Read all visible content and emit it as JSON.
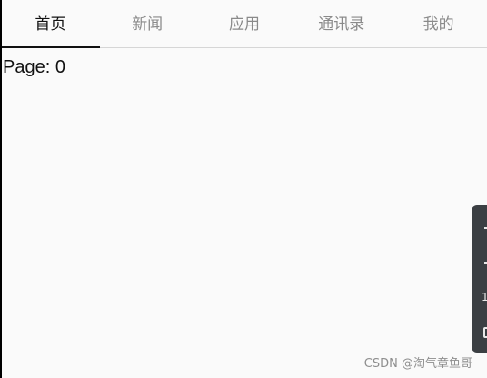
{
  "tabs": [
    {
      "label": "首页",
      "active": true
    },
    {
      "label": "新闻",
      "active": false
    },
    {
      "label": "应用",
      "active": false
    },
    {
      "label": "通讯录",
      "active": false
    },
    {
      "label": "我的",
      "active": false
    }
  ],
  "content": {
    "page_prefix": "Page:",
    "page_number": "0"
  },
  "toolbar": {
    "items": [
      {
        "icon": "dash-icon"
      },
      {
        "icon": "dash-icon"
      },
      {
        "icon": "one-icon",
        "glyph": "1"
      },
      {
        "icon": "expand-icon"
      }
    ]
  },
  "watermark": "CSDN @淘气章鱼哥",
  "colors": {
    "active_tab": "#111111",
    "inactive_tab": "#8a8a8a",
    "indicator": "#111111",
    "background": "#fafafa",
    "toolbar": "#3b3f43"
  }
}
